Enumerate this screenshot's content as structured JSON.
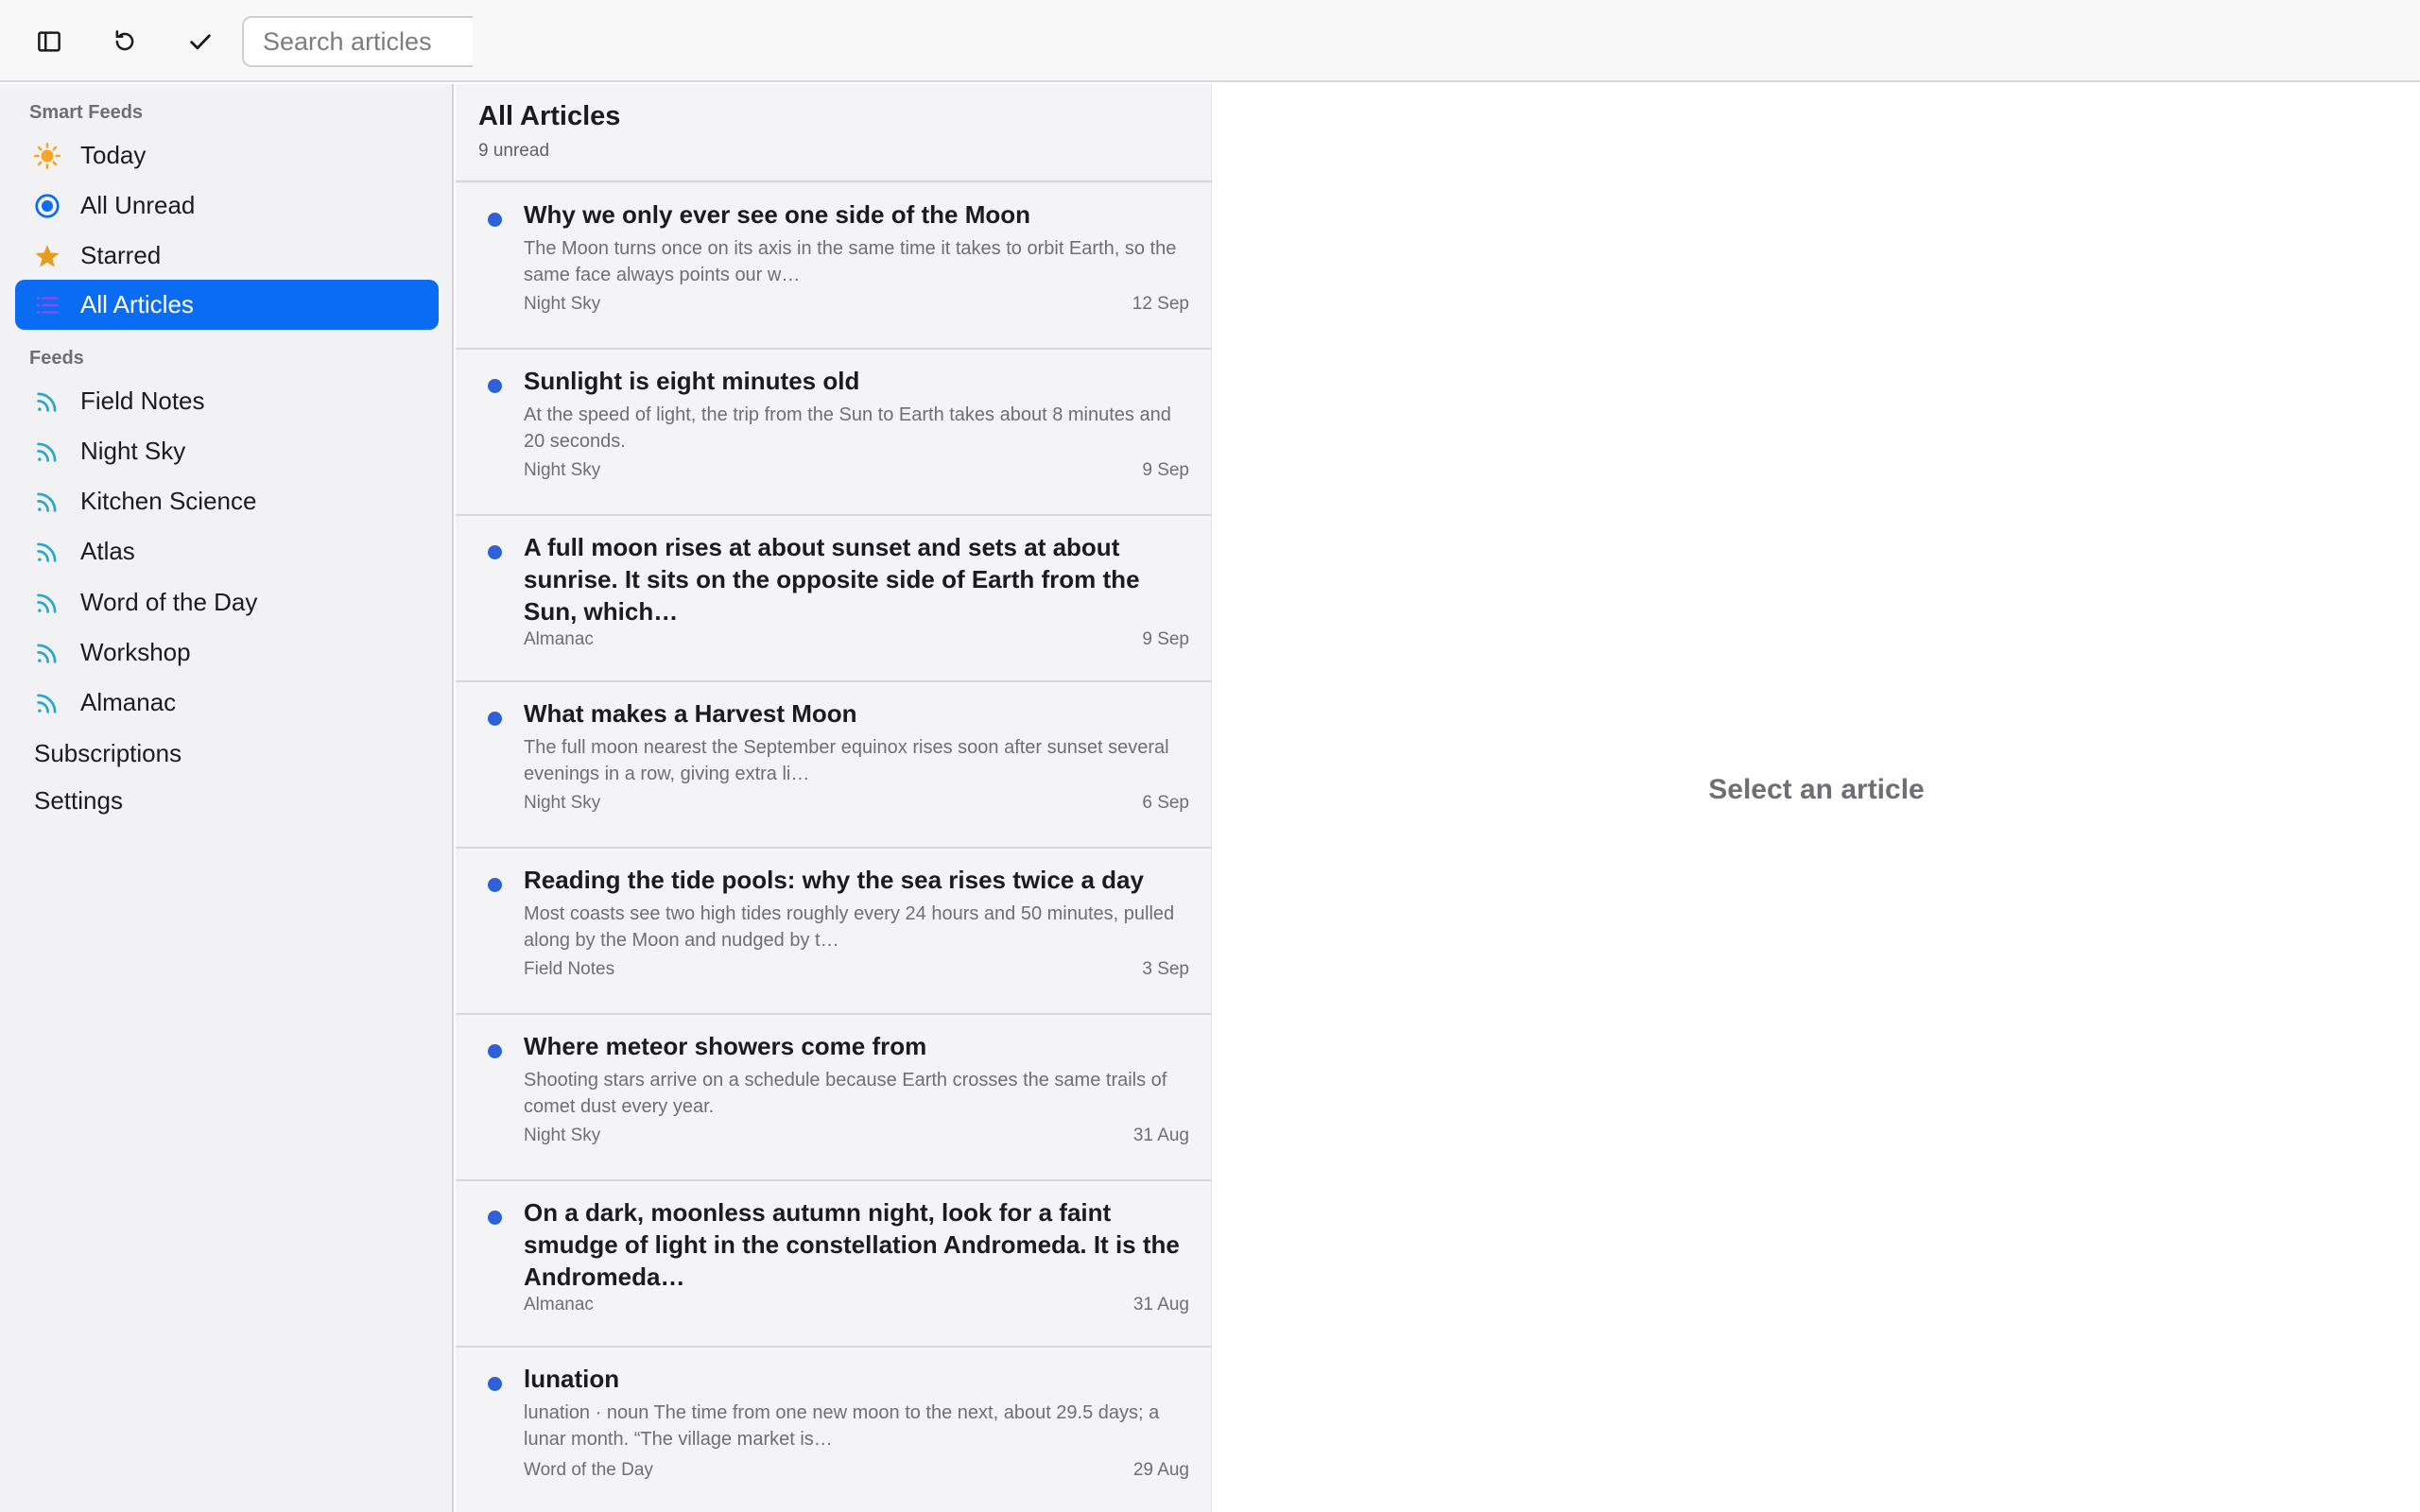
{
  "toolbar": {
    "search_placeholder": "Search articles",
    "icons": [
      "sidebar-toggle-icon",
      "refresh-icon",
      "checkmark-icon"
    ]
  },
  "sidebar": {
    "smart_feeds_header": "Smart Feeds",
    "smart_feeds": [
      {
        "label": "Today",
        "icon": "sun-icon",
        "icon_color": "#f5a623"
      },
      {
        "label": "All Unread",
        "icon": "radio-dot-icon",
        "icon_color": "#0a6cf2"
      },
      {
        "label": "Starred",
        "icon": "star-icon",
        "icon_color": "#e89c1e"
      },
      {
        "label": "All Articles",
        "icon": "list-icon",
        "icon_color": "#8a4bf0",
        "selected": true
      }
    ],
    "feeds_header": "Feeds",
    "feeds": [
      {
        "label": "Field Notes",
        "icon": "rss-icon"
      },
      {
        "label": "Night Sky",
        "icon": "rss-icon"
      },
      {
        "label": "Kitchen Science",
        "icon": "rss-icon"
      },
      {
        "label": "Atlas",
        "icon": "rss-icon"
      },
      {
        "label": "Word of the Day",
        "icon": "rss-icon"
      },
      {
        "label": "Workshop",
        "icon": "rss-icon"
      },
      {
        "label": "Almanac",
        "icon": "rss-icon"
      }
    ],
    "subscriptions_label": "Subscriptions",
    "settings_label": "Settings",
    "feed_icon_color": "#2ba8c7",
    "selection_color": "#0a6cf2"
  },
  "list": {
    "title": "All Articles",
    "count": "9 unread",
    "unread_dot_color": "#2b62d8",
    "articles": [
      {
        "title": "Why we only ever see one side of the Moon",
        "snippet": "The Moon turns once on its axis in the same time it takes to orbit Earth, so the same face always points our w…",
        "source": "Night Sky",
        "date": "12 Sep"
      },
      {
        "title": "Sunlight is eight minutes old",
        "snippet": "At the speed of light, the trip from the Sun to Earth takes about 8 minutes and 20 seconds.",
        "source": "Night Sky",
        "date": "9 Sep"
      },
      {
        "title": "A full moon rises at about sunset and sets at about sunrise. It sits on the opposite side of Earth from the Sun, which…",
        "snippet": "",
        "source": "Almanac",
        "date": "9 Sep"
      },
      {
        "title": "What makes a Harvest Moon",
        "snippet": "The full moon nearest the September equinox rises soon after sunset several evenings in a row, giving extra li…",
        "source": "Night Sky",
        "date": "6 Sep"
      },
      {
        "title": "Reading the tide pools: why the sea rises twice a day",
        "snippet": "Most coasts see two high tides roughly every 24 hours and 50 minutes, pulled along by the Moon and nudged by t…",
        "source": "Field Notes",
        "date": "3 Sep"
      },
      {
        "title": "Where meteor showers come from",
        "snippet": "Shooting stars arrive on a schedule because Earth crosses the same trails of comet dust every year.",
        "source": "Night Sky",
        "date": "31 Aug"
      },
      {
        "title": "On a dark, moonless autumn night, look for a faint smudge of light in the constellation Andromeda. It is the Andromeda…",
        "snippet": "",
        "source": "Almanac",
        "date": "31 Aug"
      },
      {
        "title": "lunation",
        "snippet": "lunation · noun The time from one new moon to the next, about 29.5 days; a lunar month. “The village market is…",
        "source": "Word of the Day",
        "date": "29 Aug"
      }
    ]
  },
  "detail": {
    "empty_message": "Select an article"
  }
}
